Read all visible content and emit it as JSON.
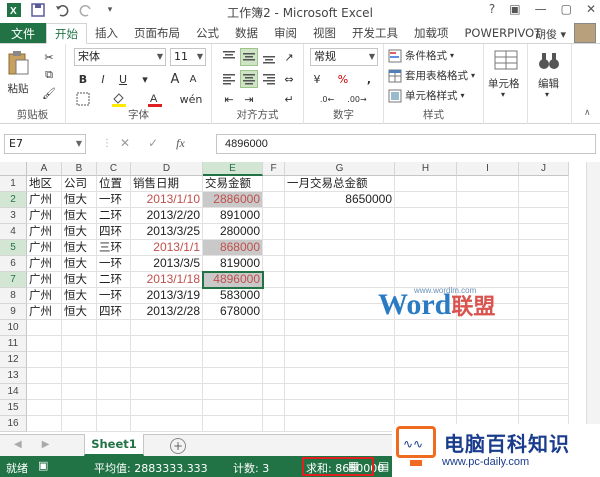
{
  "window": {
    "title": "工作簿2 - Microsoft Excel",
    "controls": [
      "?",
      "▣",
      "—",
      "▢",
      "✕"
    ]
  },
  "tabs": {
    "file": "文件",
    "items": [
      "开始",
      "插入",
      "页面布局",
      "公式",
      "数据",
      "审阅",
      "视图",
      "开发工具",
      "加载项",
      "POWERPIVOT"
    ],
    "active": "开始",
    "user": "胡俊 ▾"
  },
  "ribbon": {
    "clipboard": {
      "paste": "粘贴",
      "label": "剪贴板"
    },
    "font": {
      "name": "宋体",
      "size": "11",
      "label": "字体",
      "bold": "B",
      "italic": "I",
      "underline": "U",
      "grow": "A",
      "shrink": "A"
    },
    "alignment": {
      "label": "对齐方式"
    },
    "number": {
      "format": "常规",
      "label": "数字",
      "percent": "%",
      "comma": ",",
      "currency": "¥"
    },
    "styles": {
      "conditional": "条件格式",
      "table": "套用表格格式",
      "cell": "单元格样式",
      "label": "样式"
    },
    "cells": {
      "label": "单元格"
    },
    "editing": {
      "label": "编辑"
    }
  },
  "formula_bar": {
    "name_box": "E7",
    "fx": "fx",
    "content": "4896000"
  },
  "columns": [
    "A",
    "B",
    "C",
    "D",
    "E",
    "F",
    "G",
    "H",
    "I",
    "J"
  ],
  "rows": [
    "1",
    "2",
    "3",
    "4",
    "5",
    "6",
    "7",
    "8",
    "9",
    "10",
    "11",
    "12",
    "13",
    "14",
    "15",
    "16"
  ],
  "table": {
    "headers": [
      "地区",
      "公司",
      "位置",
      "销售日期",
      "交易金额"
    ],
    "data": [
      [
        "广州",
        "恒大",
        "一环",
        "2013/1/10",
        "2886000"
      ],
      [
        "广州",
        "恒大",
        "二环",
        "2013/2/20",
        "891000"
      ],
      [
        "广州",
        "恒大",
        "四环",
        "2013/3/25",
        "280000"
      ],
      [
        "广州",
        "恒大",
        "三环",
        "2013/1/1",
        "868000"
      ],
      [
        "广州",
        "恒大",
        "一环",
        "2013/3/5",
        "819000"
      ],
      [
        "广州",
        "恒大",
        "二环",
        "2013/1/18",
        "4896000"
      ],
      [
        "广州",
        "恒大",
        "一环",
        "2013/3/19",
        "583000"
      ],
      [
        "广州",
        "恒大",
        "四环",
        "2013/2/28",
        "678000"
      ]
    ],
    "summary_label": "一月交易总金额",
    "summary_value": "8650000"
  },
  "sheets": {
    "tab": "Sheet1",
    "add": "+"
  },
  "status": {
    "mode": "就绪",
    "average": "平均值: 2883333.333",
    "count": "计数: 3",
    "sum": "求和: 8650000"
  },
  "watermark": {
    "brand_w": "W",
    "brand_rest": "ord",
    "brand_cn": "联盟",
    "url": "www.wordlm.com"
  },
  "logo": {
    "name": "电脑百科知识",
    "url": "www.pc-daily.com"
  },
  "colors": {
    "excel_green": "#217346",
    "red_text": "#c0504d",
    "highlight": "#c9c9c9"
  }
}
